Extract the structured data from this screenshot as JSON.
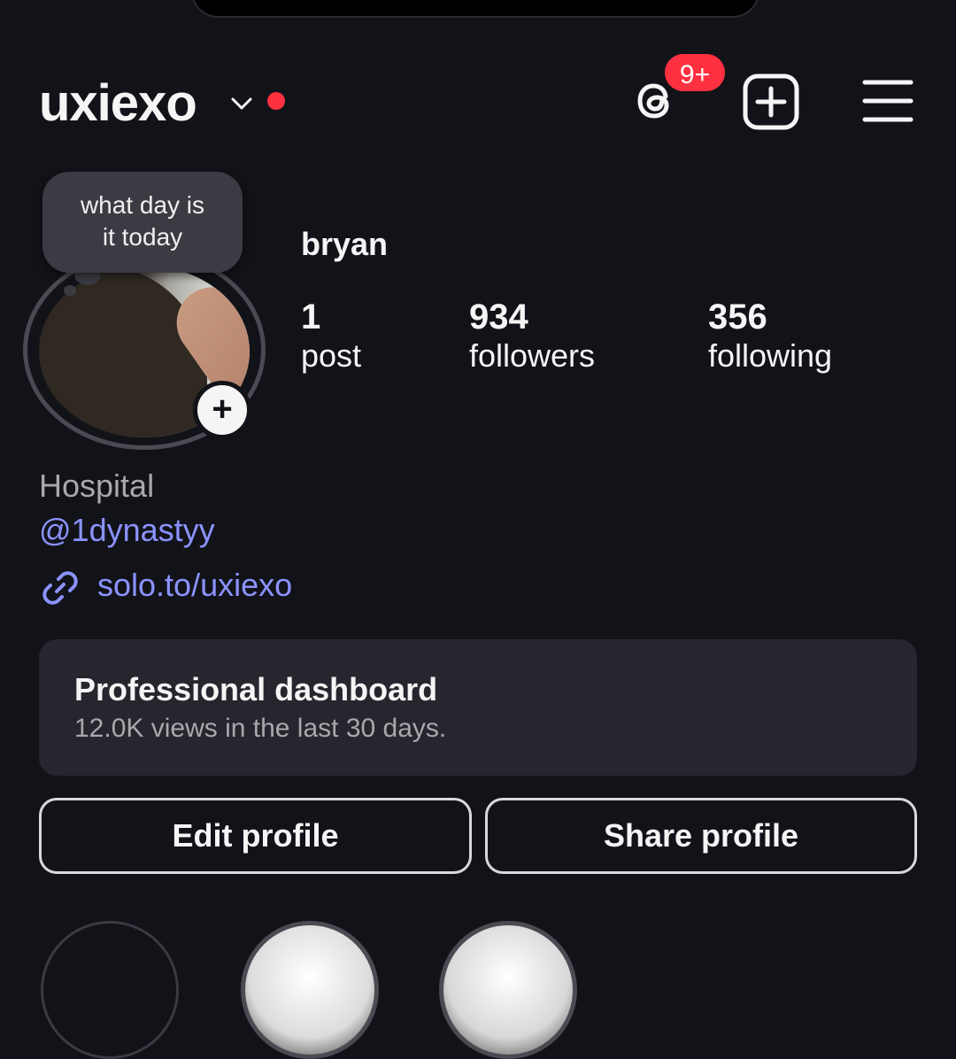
{
  "header": {
    "username": "uxiexo",
    "notification_badge": "9+",
    "icons": [
      "threads-icon",
      "new-post-icon",
      "menu-icon"
    ],
    "live_dot_color": "#ff3040"
  },
  "note": {
    "text_line1": "what day is",
    "text_line2": "it today"
  },
  "profile": {
    "display_name": "bryan",
    "stats": [
      {
        "value": "1",
        "label": "post"
      },
      {
        "value": "934",
        "label": "followers"
      },
      {
        "value": "356",
        "label": "following"
      }
    ],
    "category": "Hospital",
    "mention": "@1dynastyy",
    "link": "solo.to/uxiexo"
  },
  "dashboard": {
    "title": "Professional dashboard",
    "subtitle": "12.0K views in the last 30 days."
  },
  "actions": {
    "edit": "Edit profile",
    "share": "Share profile"
  },
  "colors": {
    "background": "#121319",
    "card": "#26272e",
    "link": "#8b93ff",
    "badge": "#ff3040"
  }
}
